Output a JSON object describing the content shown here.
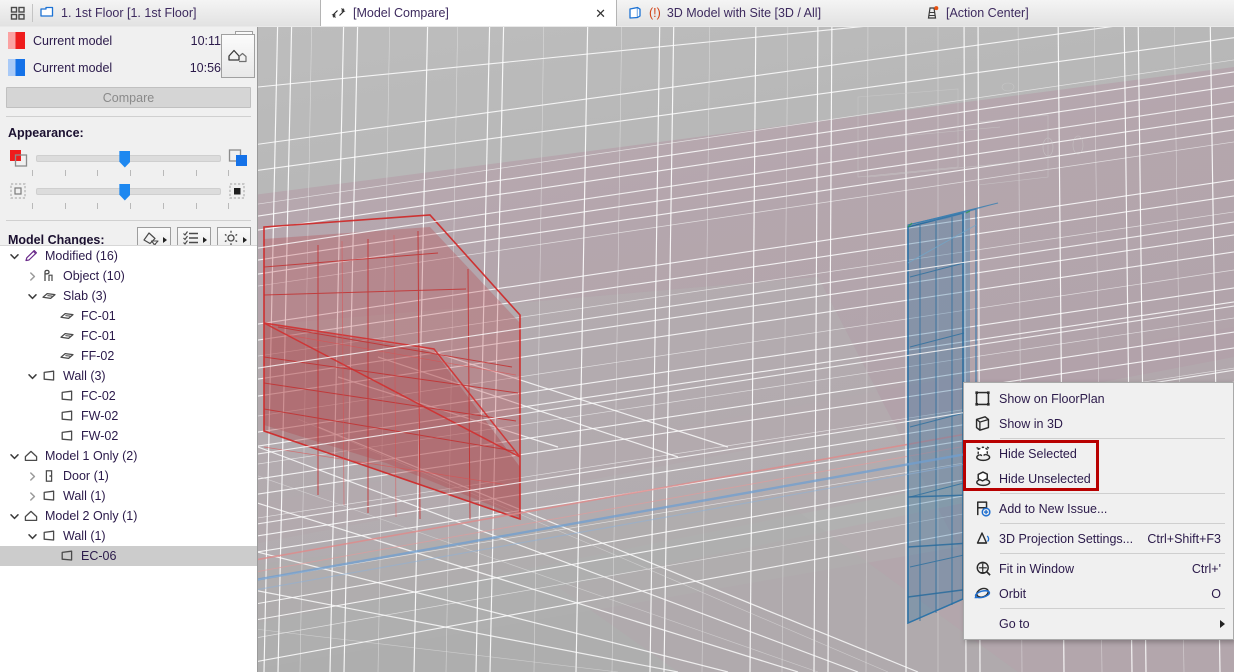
{
  "tabs": [
    {
      "label": "1. 1st Floor [1. 1st Floor]",
      "icon": "floor-plan-icon",
      "state": "inactive",
      "warn": ""
    },
    {
      "label": "[Model Compare]",
      "icon": "model-compare-icon",
      "state": "active",
      "warn": ""
    },
    {
      "label": "3D Model with Site [3D / All]",
      "icon": "cube-icon",
      "state": "inactive",
      "warn": "(!)"
    },
    {
      "label": "[Action Center]",
      "icon": "action-center-icon",
      "state": "inactive",
      "warn": ""
    }
  ],
  "tabbar": {
    "grid_icon": "grid-view-icon",
    "close_glyph": "✕"
  },
  "panel": {
    "models": [
      {
        "name": "Current model",
        "time": "10:11",
        "color": "#ef1c1c",
        "swatch": "red"
      },
      {
        "name": "Current model",
        "time": "10:56",
        "color": "#1572e8",
        "swatch": "blue"
      }
    ],
    "compare_label": "Compare",
    "appearance_label": "Appearance:",
    "sliders": [
      {
        "name": "color-blend-slider",
        "value_pct": 48,
        "left_icon": "red-square-overlap-icon",
        "right_icon": "blue-square-overlap-icon"
      },
      {
        "name": "transparency-slider",
        "value_pct": 48,
        "left_icon": "empty-square-icon",
        "right_icon": "filled-square-icon"
      }
    ],
    "model_changes_label": "Model Changes:",
    "tools": [
      {
        "name": "filter-elements-button",
        "icon": "filter-marquee-icon"
      },
      {
        "name": "list-options-button",
        "icon": "checklist-icon"
      },
      {
        "name": "settings-button",
        "icon": "gear-icon"
      }
    ],
    "swap_button": "swap-models-icon"
  },
  "tree": [
    {
      "depth": 0,
      "twisty": "open",
      "icon": "pencil-icon",
      "label": "Modified (16)",
      "selected": false
    },
    {
      "depth": 1,
      "twisty": "closed",
      "icon": "object-icon",
      "label": "Object (10)",
      "selected": false
    },
    {
      "depth": 1,
      "twisty": "open",
      "icon": "slab-icon",
      "label": "Slab (3)",
      "selected": false
    },
    {
      "depth": 2,
      "twisty": "none",
      "icon": "slab-icon",
      "label": "FC-01",
      "selected": false
    },
    {
      "depth": 2,
      "twisty": "none",
      "icon": "slab-icon",
      "label": "FC-01",
      "selected": false
    },
    {
      "depth": 2,
      "twisty": "none",
      "icon": "slab-icon",
      "label": "FF-02",
      "selected": false
    },
    {
      "depth": 1,
      "twisty": "open",
      "icon": "wall-icon",
      "label": "Wall (3)",
      "selected": false
    },
    {
      "depth": 2,
      "twisty": "none",
      "icon": "wall-icon",
      "label": "FC-02",
      "selected": false
    },
    {
      "depth": 2,
      "twisty": "none",
      "icon": "wall-icon",
      "label": "FW-02",
      "selected": false
    },
    {
      "depth": 2,
      "twisty": "none",
      "icon": "wall-icon",
      "label": "FW-02",
      "selected": false
    },
    {
      "depth": 0,
      "twisty": "open",
      "icon": "house-icon",
      "label": "Model 1 Only (2)",
      "selected": false
    },
    {
      "depth": 1,
      "twisty": "closed",
      "icon": "door-icon",
      "label": "Door (1)",
      "selected": false
    },
    {
      "depth": 1,
      "twisty": "closed",
      "icon": "wall-icon",
      "label": "Wall (1)",
      "selected": false
    },
    {
      "depth": 0,
      "twisty": "open",
      "icon": "house-icon",
      "label": "Model 2 Only (1)",
      "selected": false
    },
    {
      "depth": 1,
      "twisty": "open",
      "icon": "wall-icon",
      "label": "Wall (1)",
      "selected": false
    },
    {
      "depth": 2,
      "twisty": "none",
      "icon": "wall-icon",
      "label": "EC-06",
      "selected": true
    }
  ],
  "context_menu": {
    "highlight_color": "#b80000",
    "items": [
      {
        "icon": "floorplan-square-icon",
        "label": "Show on FloorPlan",
        "shortcut": "",
        "submenu": false,
        "sep_after": false,
        "highlighted": false
      },
      {
        "icon": "cube-3d-icon",
        "label": "Show in 3D",
        "shortcut": "",
        "submenu": false,
        "sep_after": true,
        "highlighted": false
      },
      {
        "icon": "hide-selected-icon",
        "label": "Hide Selected",
        "shortcut": "",
        "submenu": false,
        "sep_after": false,
        "highlighted": true
      },
      {
        "icon": "hide-unselected-icon",
        "label": "Hide Unselected",
        "shortcut": "",
        "submenu": false,
        "sep_after": true,
        "highlighted": true
      },
      {
        "icon": "add-issue-icon",
        "label": "Add to New Issue...",
        "shortcut": "",
        "submenu": false,
        "sep_after": true,
        "highlighted": false
      },
      {
        "icon": "projection-icon",
        "label": "3D Projection Settings...",
        "shortcut": "Ctrl+Shift+F3",
        "submenu": false,
        "sep_after": true,
        "highlighted": false
      },
      {
        "icon": "fit-window-icon",
        "label": "Fit in Window",
        "shortcut": "Ctrl+'",
        "submenu": false,
        "sep_after": false,
        "highlighted": false
      },
      {
        "icon": "orbit-icon",
        "label": "Orbit",
        "shortcut": "O",
        "submenu": false,
        "sep_after": true,
        "highlighted": false
      },
      {
        "icon": "",
        "label": "Go to",
        "shortcut": "",
        "submenu": true,
        "sep_after": false,
        "highlighted": false
      }
    ]
  },
  "viewport": {
    "name": "3d-model-viewport",
    "bg_color": "#b9b9b9",
    "model1_color": "#c0392b",
    "model2_color": "#2d6fa8",
    "overlay_tint": "#b9a3ac"
  }
}
